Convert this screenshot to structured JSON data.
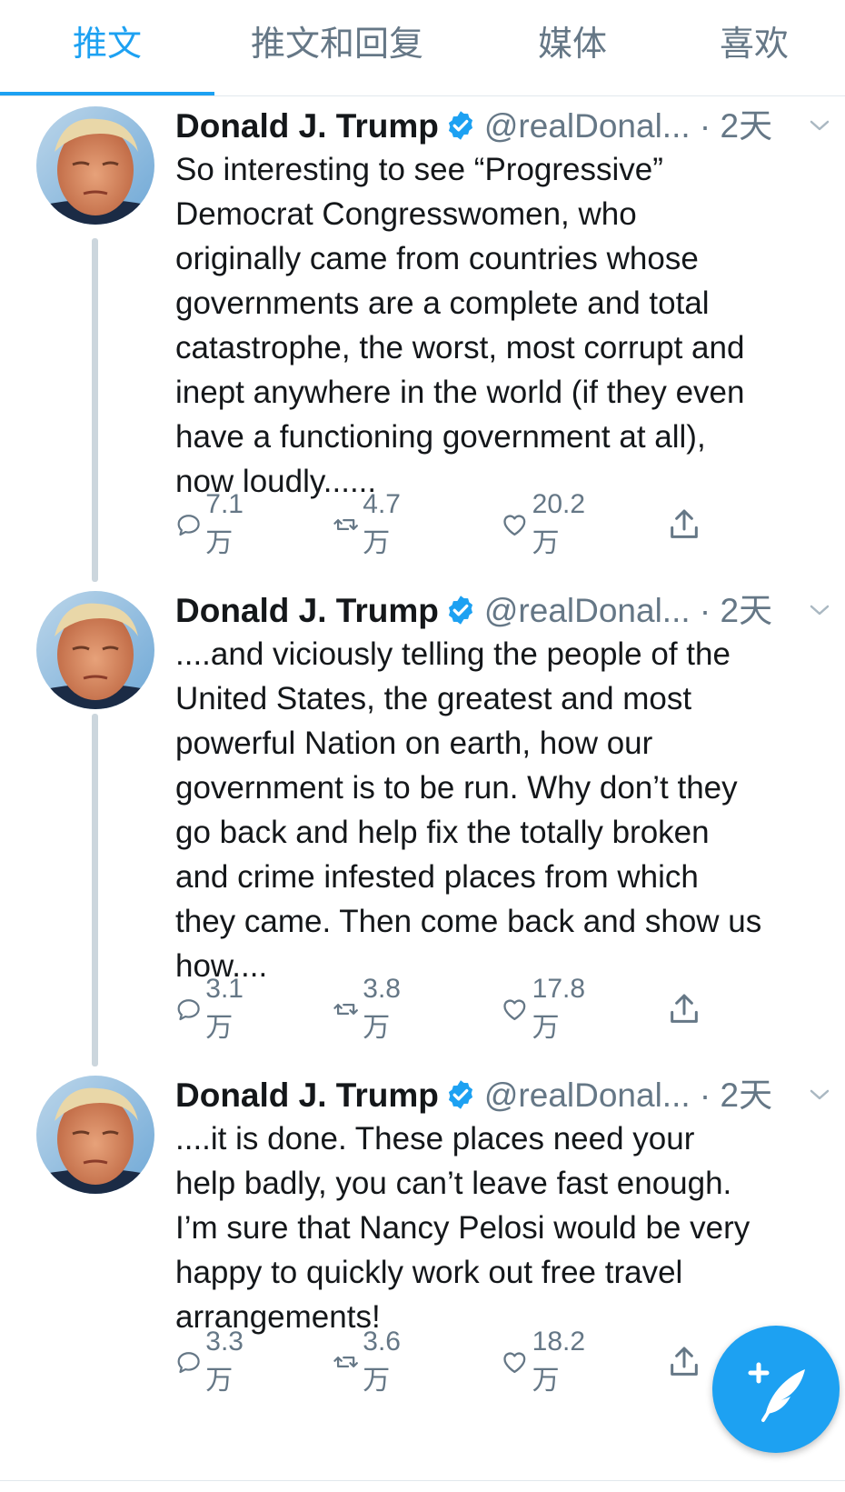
{
  "tabs": [
    {
      "label": "推文",
      "active": true
    },
    {
      "label": "推文和回复",
      "active": false
    },
    {
      "label": "媒体",
      "active": false
    },
    {
      "label": "喜欢",
      "active": false
    }
  ],
  "tweets": [
    {
      "name": "Donald J. Trump",
      "handle": "@realDonal...",
      "time": "· 2天",
      "text": "So interesting to see “Progressive”\nDemocrat Congresswomen, who\noriginally came from countries whose\ngovernments are a complete and total\ncatastrophe, the worst, most corrupt and\ninept anywhere in the world (if they even\nhave a functioning government at all),\nnow loudly......",
      "replies": "7.1万",
      "retweets": "4.7万",
      "likes": "20.2万"
    },
    {
      "name": "Donald J. Trump",
      "handle": "@realDonal...",
      "time": "· 2天",
      "text": "....and viciously telling the people of the\nUnited States, the greatest and most\npowerful Nation on earth, how our\ngovernment is to be run. Why don’t they\ngo back and help fix the totally broken\nand crime infested places from which\nthey came. Then come back and show us\nhow....",
      "replies": "3.1万",
      "retweets": "3.8万",
      "likes": "17.8万"
    },
    {
      "name": "Donald J. Trump",
      "handle": "@realDonal...",
      "time": "· 2天",
      "text": "....it is done. These places need your\nhelp badly, you can’t leave fast enough.\nI’m sure that Nancy Pelosi would be very\nhappy to quickly work out free travel\narrangements!",
      "replies": "3.3万",
      "retweets": "3.6万",
      "likes": "18.2万"
    }
  ],
  "colors": {
    "accent": "#1da1f2",
    "secondary_text": "#657786"
  },
  "icons": [
    "verified-badge-icon",
    "chevron-down-icon",
    "reply-icon",
    "retweet-icon",
    "like-icon",
    "share-icon",
    "compose-tweet-icon"
  ]
}
